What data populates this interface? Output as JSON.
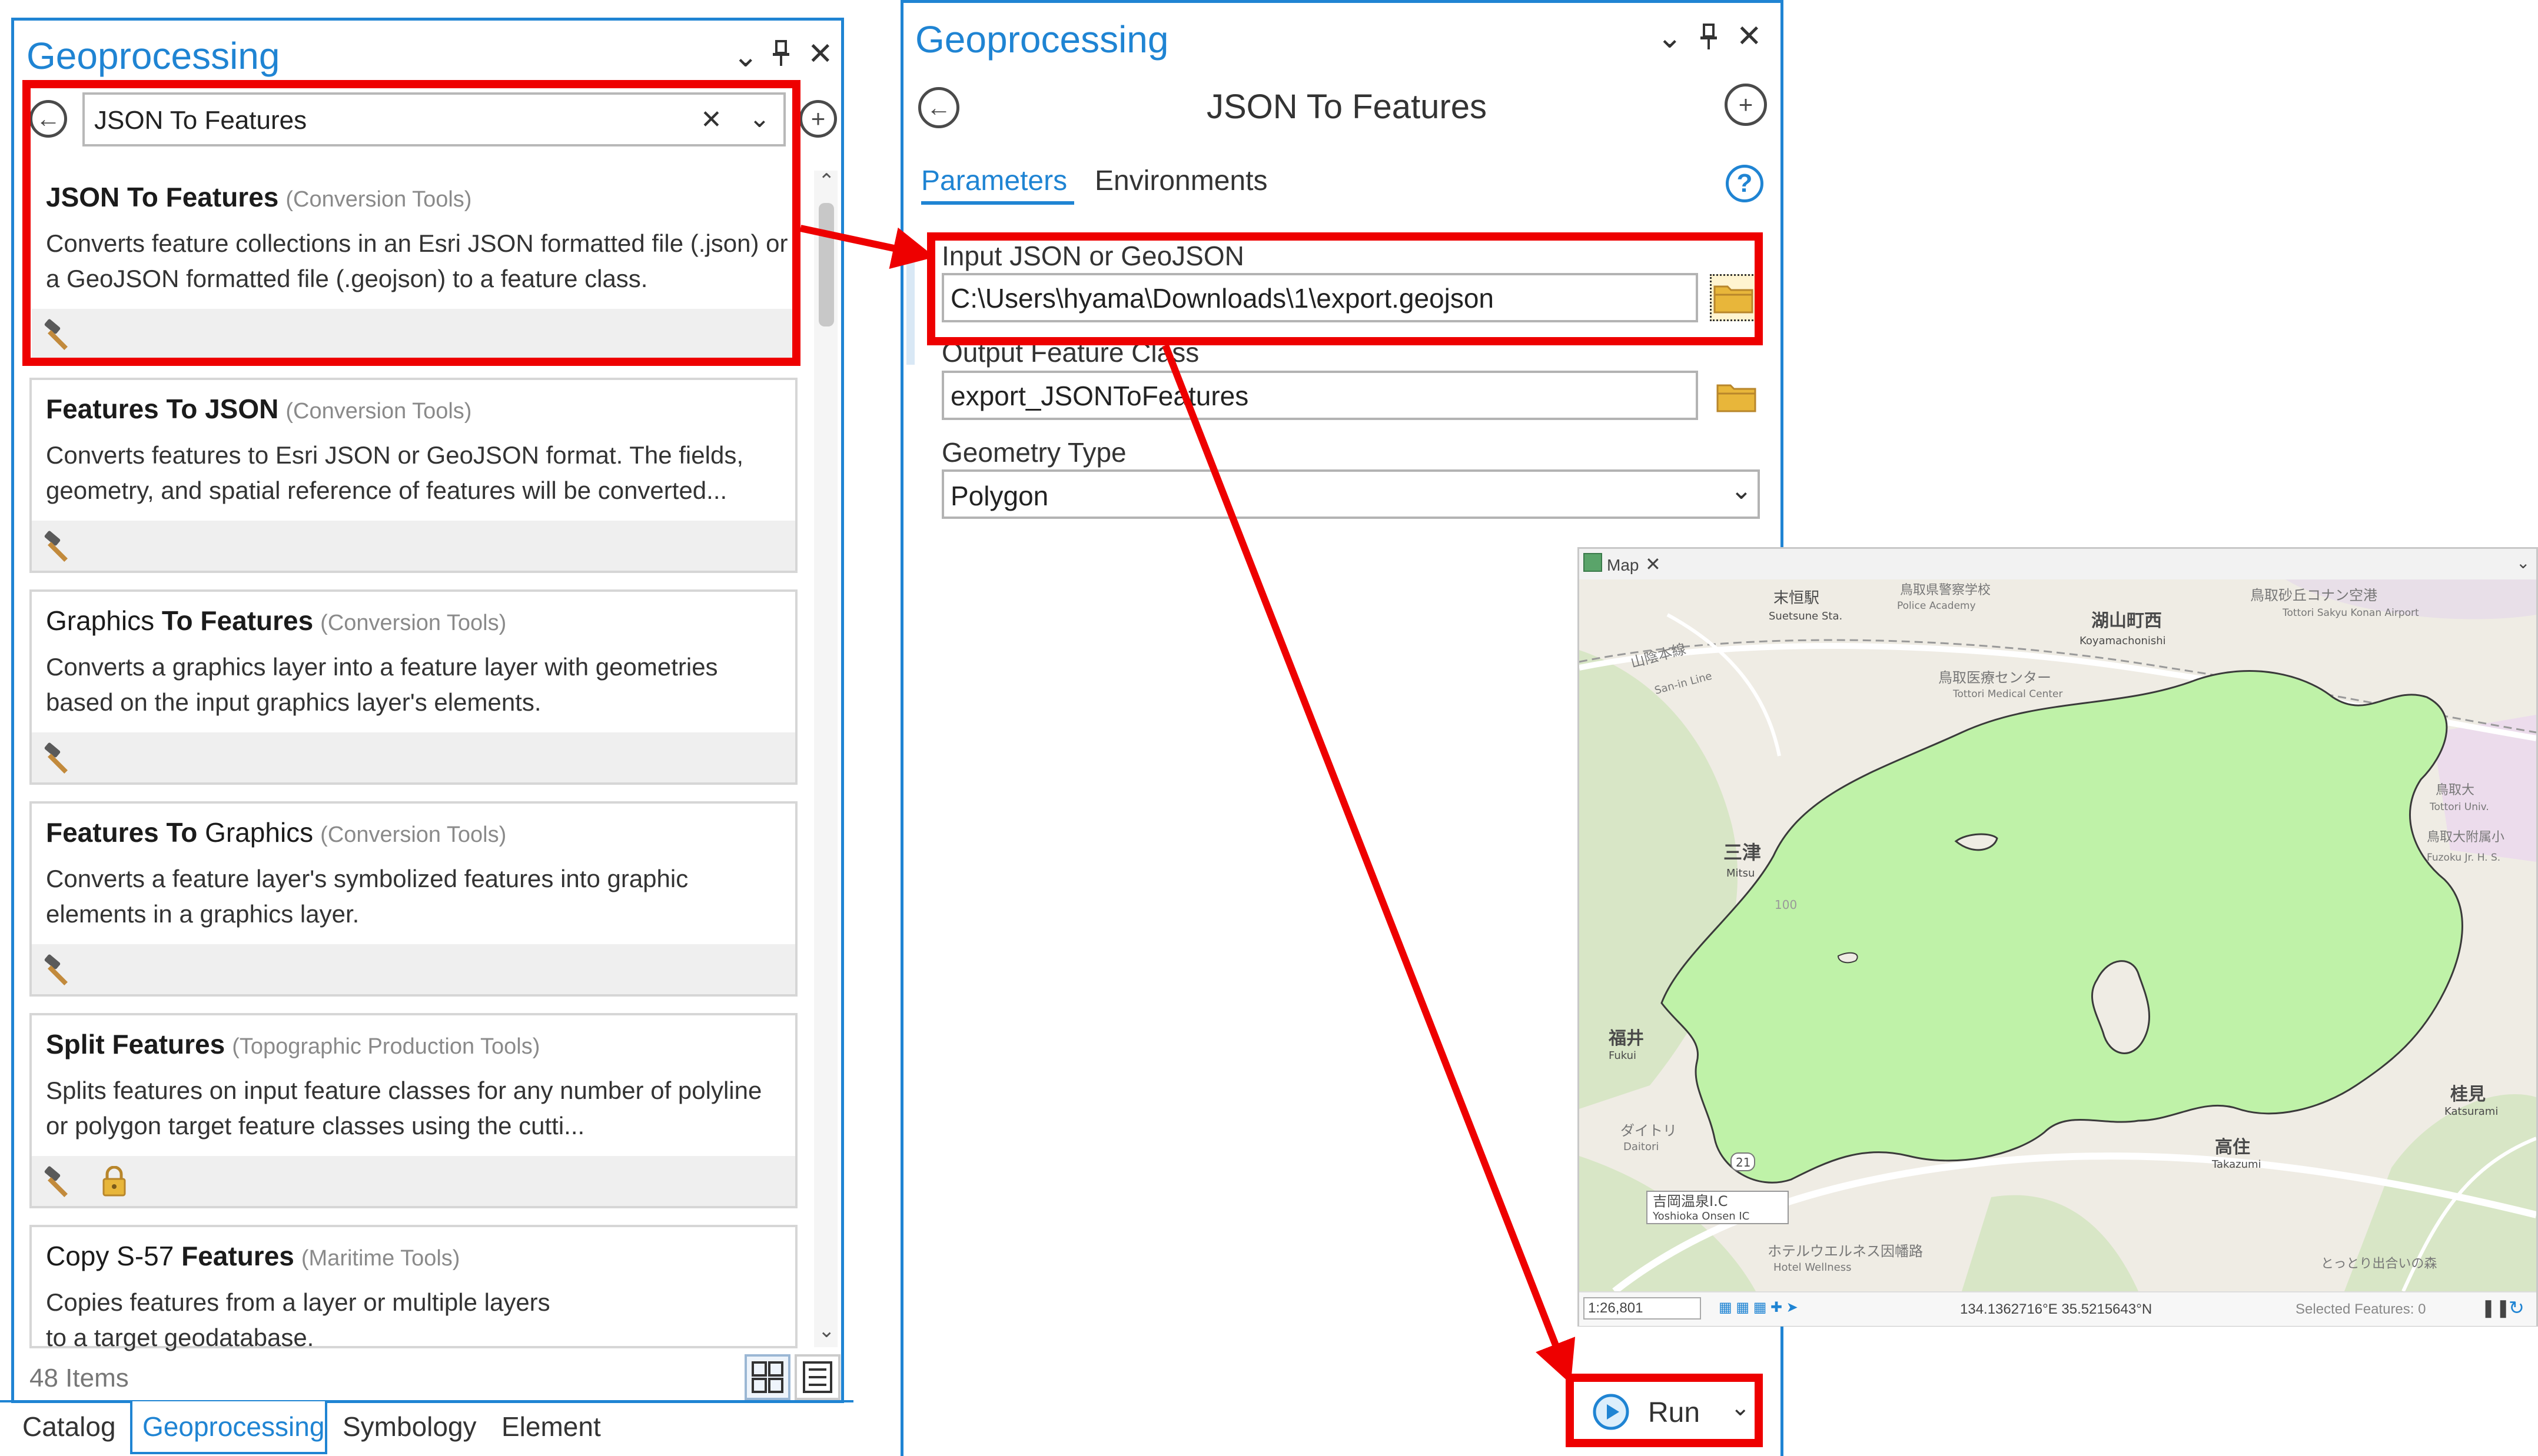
{
  "left_pane": {
    "title": "Geoprocessing",
    "search_value": "JSON To Features",
    "items_count": "48 Items",
    "results": [
      {
        "name": "JSON To Features",
        "category": "(Conversion Tools)",
        "description": "Converts feature collections in an Esri JSON formatted file (.json) or a GeoJSON formatted file (.geojson) to a feature class.",
        "locked": false
      },
      {
        "name": "Features To JSON",
        "category": "(Conversion Tools)",
        "description": "Converts features to Esri JSON or GeoJSON format. The fields, geometry, and spatial reference of features will be converted...",
        "locked": false
      },
      {
        "name_plain": "Graphics",
        "name": "To Features",
        "category": "(Conversion Tools)",
        "description": "Converts a graphics layer into a feature layer with geometries based on the input graphics layer's elements.",
        "locked": false
      },
      {
        "name": "Features To",
        "name_plain": "Graphics",
        "category": "(Conversion Tools)",
        "description": "Converts a feature layer's symbolized features into graphic elements in a graphics layer.",
        "locked": false
      },
      {
        "name": "Split Features",
        "category": "(Topographic Production Tools)",
        "description": "Splits features on input feature classes for any number of polyline or polygon target feature classes using the cutti...",
        "locked": true
      },
      {
        "name_plain": "Copy S-57",
        "name": "Features",
        "category": "(Maritime Tools)",
        "description": "Copies features from a layer or multiple layers to a target geodatabase.",
        "locked": false
      }
    ],
    "bottom_tabs": [
      "Catalog",
      "Geoprocessing",
      "Symbology",
      "Element"
    ],
    "active_tab": "Geoprocessing"
  },
  "tool_pane": {
    "title": "Geoprocessing",
    "tool_name": "JSON To Features",
    "tabs": [
      "Parameters",
      "Environments"
    ],
    "active_tab": "Parameters",
    "params": [
      {
        "label": "Input JSON or GeoJSON",
        "value": "C:\\Users\\hyama\\Downloads\\1\\export.geojson"
      },
      {
        "label": "Output Feature Class",
        "value": "export_JSONToFeatures"
      },
      {
        "label": "Geometry Type",
        "value": "Polygon"
      }
    ],
    "run_label": "Run"
  },
  "map": {
    "tab_label": "Map",
    "scale": "1:26,801",
    "coords": "134.1362716°E 35.5215643°N",
    "selected_features": "Selected Features: 0",
    "labels": {
      "station": "末恒駅",
      "station_en": "Suetsune Sta.",
      "koyama": "湖山町西",
      "koyama_en": "Koyamachonishi",
      "police": "鳥取県警察学校",
      "police_en": "Police Academy",
      "airport": "鳥取砂丘コナン空港",
      "airport_en": "Tottori Sakyu Konan Airport",
      "medical": "鳥取医療センター",
      "medical_en": "Tottori Medical Center",
      "sanin": "山陰本線",
      "sanin_en": "San-in Line",
      "mitsu": "三津",
      "mitsu_en": "Mitsu",
      "fukui": "福井",
      "fukui_en": "Fukui",
      "takazumi": "高住",
      "takazumi_en": "Takazumi",
      "katsumi": "桂見",
      "katsumi_en": "Katsurami",
      "daitori": "ダイトリ",
      "daitori_en": "Daitori",
      "yoshioka": "吉岡温泉I.C",
      "yoshioka_en": "Yoshioka Onsen IC",
      "hotel": "ホテルウエルネス因幡路",
      "hotel_en": "Hotel Wellness",
      "univ": "鳥取大",
      "univ_en": "Tottori Univ.",
      "fuzoku": "鳥取大附属小",
      "fuzoku_en": "Fuzoku Jr. H. S.",
      "forest": "とっとり出合いの森",
      "route": "21",
      "hill": "100"
    },
    "colors": {
      "lake_fill": "#bff2a8",
      "lake_stroke": "#3a3a3a",
      "land": "#efece4",
      "forest": "#d8e6c6",
      "road": "#ffffff"
    }
  },
  "colors": {
    "accent": "#1f84d3",
    "annotation": "#ee0000",
    "folder": "#e8b63a"
  }
}
